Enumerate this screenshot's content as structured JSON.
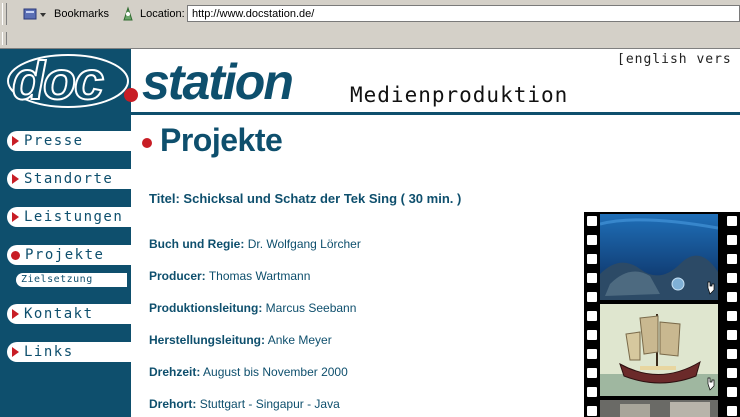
{
  "browser": {
    "bookmarks_label": "Bookmarks",
    "location_label": "Location:",
    "url": "http://www.docstation.de/"
  },
  "site": {
    "logo_text_doc": "doc",
    "logo_text_station": "station",
    "tagline": "Medienproduktion",
    "english_link": "[english vers",
    "nav": {
      "presse": "Presse",
      "standorte": "Standorte",
      "leistungen": "Leistungen",
      "projekte": "Projekte",
      "zielsetzung": "Zielsetzung",
      "kontakt": "Kontakt",
      "links": "Links"
    },
    "page_heading": "Projekte",
    "project_title": "Titel: Schicksal und Schatz der Tek Sing ( 30 min. )",
    "credits": [
      {
        "label": "Buch und Regie:",
        "value": "Dr. Wolfgang Lörcher"
      },
      {
        "label": "Producer:",
        "value": "Thomas Wartmann"
      },
      {
        "label": "Produktionsleitung:",
        "value": "Marcus Seebann"
      },
      {
        "label": "Herstellungsleitung:",
        "value": "Anke Meyer"
      },
      {
        "label": "Drehzeit:",
        "value": "August bis November 2000"
      },
      {
        "label": "Drehort:",
        "value": "Stuttgart - Singapur - Java"
      }
    ]
  },
  "colors": {
    "brand_blue": "#0e4f6d",
    "accent_red": "#c81d25",
    "chrome_gray": "#d4d0c8"
  }
}
